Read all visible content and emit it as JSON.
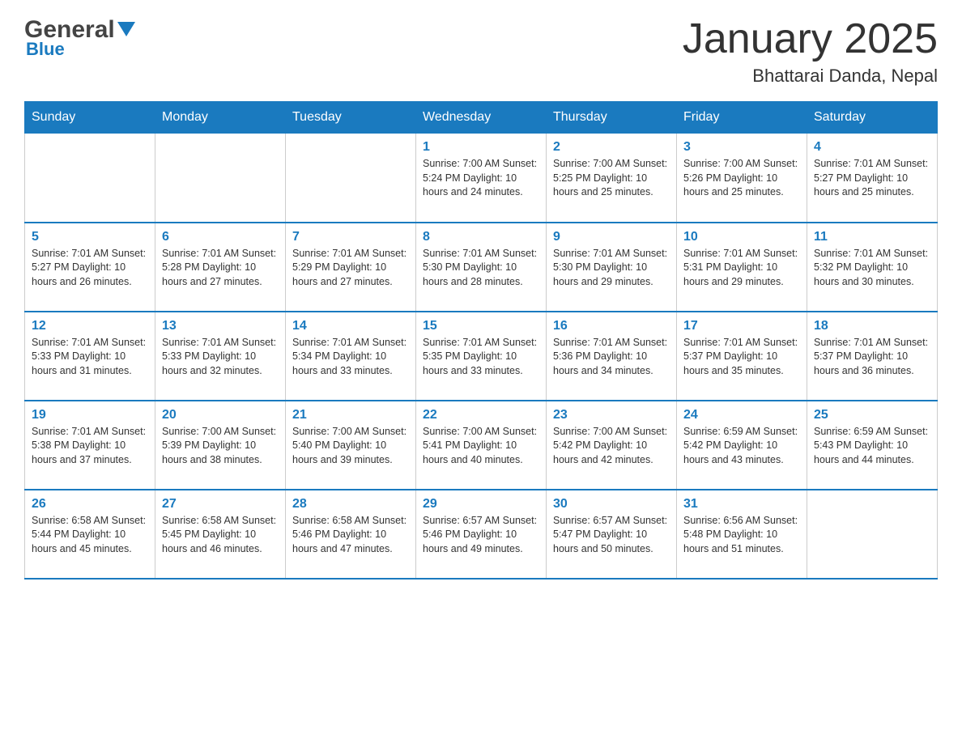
{
  "logo": {
    "text_general": "General",
    "text_blue": "Blue",
    "arrow_color": "#1a7abf"
  },
  "title": "January 2025",
  "subtitle": "Bhattarai Danda, Nepal",
  "days_of_week": [
    "Sunday",
    "Monday",
    "Tuesday",
    "Wednesday",
    "Thursday",
    "Friday",
    "Saturday"
  ],
  "weeks": [
    [
      {
        "day": "",
        "info": ""
      },
      {
        "day": "",
        "info": ""
      },
      {
        "day": "",
        "info": ""
      },
      {
        "day": "1",
        "info": "Sunrise: 7:00 AM\nSunset: 5:24 PM\nDaylight: 10 hours\nand 24 minutes."
      },
      {
        "day": "2",
        "info": "Sunrise: 7:00 AM\nSunset: 5:25 PM\nDaylight: 10 hours\nand 25 minutes."
      },
      {
        "day": "3",
        "info": "Sunrise: 7:00 AM\nSunset: 5:26 PM\nDaylight: 10 hours\nand 25 minutes."
      },
      {
        "day": "4",
        "info": "Sunrise: 7:01 AM\nSunset: 5:27 PM\nDaylight: 10 hours\nand 25 minutes."
      }
    ],
    [
      {
        "day": "5",
        "info": "Sunrise: 7:01 AM\nSunset: 5:27 PM\nDaylight: 10 hours\nand 26 minutes."
      },
      {
        "day": "6",
        "info": "Sunrise: 7:01 AM\nSunset: 5:28 PM\nDaylight: 10 hours\nand 27 minutes."
      },
      {
        "day": "7",
        "info": "Sunrise: 7:01 AM\nSunset: 5:29 PM\nDaylight: 10 hours\nand 27 minutes."
      },
      {
        "day": "8",
        "info": "Sunrise: 7:01 AM\nSunset: 5:30 PM\nDaylight: 10 hours\nand 28 minutes."
      },
      {
        "day": "9",
        "info": "Sunrise: 7:01 AM\nSunset: 5:30 PM\nDaylight: 10 hours\nand 29 minutes."
      },
      {
        "day": "10",
        "info": "Sunrise: 7:01 AM\nSunset: 5:31 PM\nDaylight: 10 hours\nand 29 minutes."
      },
      {
        "day": "11",
        "info": "Sunrise: 7:01 AM\nSunset: 5:32 PM\nDaylight: 10 hours\nand 30 minutes."
      }
    ],
    [
      {
        "day": "12",
        "info": "Sunrise: 7:01 AM\nSunset: 5:33 PM\nDaylight: 10 hours\nand 31 minutes."
      },
      {
        "day": "13",
        "info": "Sunrise: 7:01 AM\nSunset: 5:33 PM\nDaylight: 10 hours\nand 32 minutes."
      },
      {
        "day": "14",
        "info": "Sunrise: 7:01 AM\nSunset: 5:34 PM\nDaylight: 10 hours\nand 33 minutes."
      },
      {
        "day": "15",
        "info": "Sunrise: 7:01 AM\nSunset: 5:35 PM\nDaylight: 10 hours\nand 33 minutes."
      },
      {
        "day": "16",
        "info": "Sunrise: 7:01 AM\nSunset: 5:36 PM\nDaylight: 10 hours\nand 34 minutes."
      },
      {
        "day": "17",
        "info": "Sunrise: 7:01 AM\nSunset: 5:37 PM\nDaylight: 10 hours\nand 35 minutes."
      },
      {
        "day": "18",
        "info": "Sunrise: 7:01 AM\nSunset: 5:37 PM\nDaylight: 10 hours\nand 36 minutes."
      }
    ],
    [
      {
        "day": "19",
        "info": "Sunrise: 7:01 AM\nSunset: 5:38 PM\nDaylight: 10 hours\nand 37 minutes."
      },
      {
        "day": "20",
        "info": "Sunrise: 7:00 AM\nSunset: 5:39 PM\nDaylight: 10 hours\nand 38 minutes."
      },
      {
        "day": "21",
        "info": "Sunrise: 7:00 AM\nSunset: 5:40 PM\nDaylight: 10 hours\nand 39 minutes."
      },
      {
        "day": "22",
        "info": "Sunrise: 7:00 AM\nSunset: 5:41 PM\nDaylight: 10 hours\nand 40 minutes."
      },
      {
        "day": "23",
        "info": "Sunrise: 7:00 AM\nSunset: 5:42 PM\nDaylight: 10 hours\nand 42 minutes."
      },
      {
        "day": "24",
        "info": "Sunrise: 6:59 AM\nSunset: 5:42 PM\nDaylight: 10 hours\nand 43 minutes."
      },
      {
        "day": "25",
        "info": "Sunrise: 6:59 AM\nSunset: 5:43 PM\nDaylight: 10 hours\nand 44 minutes."
      }
    ],
    [
      {
        "day": "26",
        "info": "Sunrise: 6:58 AM\nSunset: 5:44 PM\nDaylight: 10 hours\nand 45 minutes."
      },
      {
        "day": "27",
        "info": "Sunrise: 6:58 AM\nSunset: 5:45 PM\nDaylight: 10 hours\nand 46 minutes."
      },
      {
        "day": "28",
        "info": "Sunrise: 6:58 AM\nSunset: 5:46 PM\nDaylight: 10 hours\nand 47 minutes."
      },
      {
        "day": "29",
        "info": "Sunrise: 6:57 AM\nSunset: 5:46 PM\nDaylight: 10 hours\nand 49 minutes."
      },
      {
        "day": "30",
        "info": "Sunrise: 6:57 AM\nSunset: 5:47 PM\nDaylight: 10 hours\nand 50 minutes."
      },
      {
        "day": "31",
        "info": "Sunrise: 6:56 AM\nSunset: 5:48 PM\nDaylight: 10 hours\nand 51 minutes."
      },
      {
        "day": "",
        "info": ""
      }
    ]
  ],
  "accent_color": "#1a7abf"
}
